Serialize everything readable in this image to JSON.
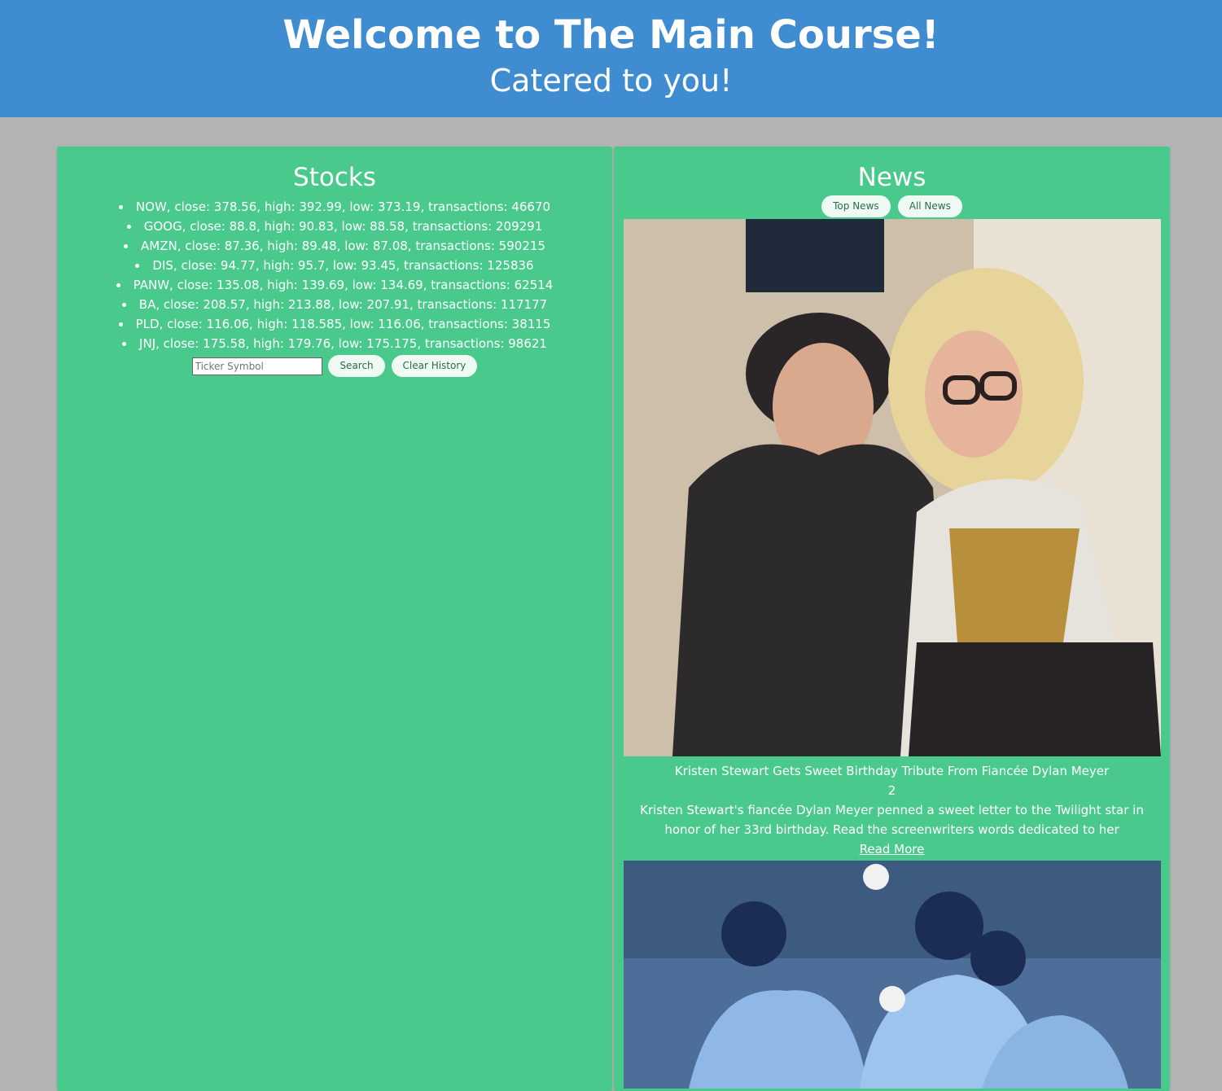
{
  "header": {
    "title": "Welcome to The Main Course!",
    "subtitle": "Catered to you!"
  },
  "stocks": {
    "title": "Stocks",
    "items": [
      "NOW, close: 378.56, high: 392.99, low: 373.19, transactions: 46670",
      "GOOG, close: 88.8, high: 90.83, low: 88.58, transactions: 209291",
      "AMZN, close: 87.36, high: 89.48, low: 87.08, transactions: 590215",
      "DIS, close: 94.77, high: 95.7, low: 93.45, transactions: 125836",
      "PANW, close: 135.08, high: 139.69, low: 134.69, transactions: 62514",
      "BA, close: 208.57, high: 213.88, low: 207.91, transactions: 117177",
      "PLD, close: 116.06, high: 118.585, low: 116.06, transactions: 38115",
      "JNJ, close: 175.58, high: 179.76, low: 175.175, transactions: 98621"
    ],
    "search_placeholder": "Ticker Symbol",
    "search_label": "Search",
    "clear_label": "Clear History"
  },
  "news": {
    "title": "News",
    "top_label": "Top News",
    "all_label": "All News",
    "articles": [
      {
        "title": "Kristen Stewart Gets Sweet Birthday Tribute From Fiancée Dylan Meyer",
        "meta": "2",
        "description": "Kristen Stewart's fiancée Dylan Meyer penned a sweet letter to the Twilight star in honor of her 33rd birthday. Read the screenwriters words dedicated to her",
        "link": "Read More"
      }
    ]
  }
}
